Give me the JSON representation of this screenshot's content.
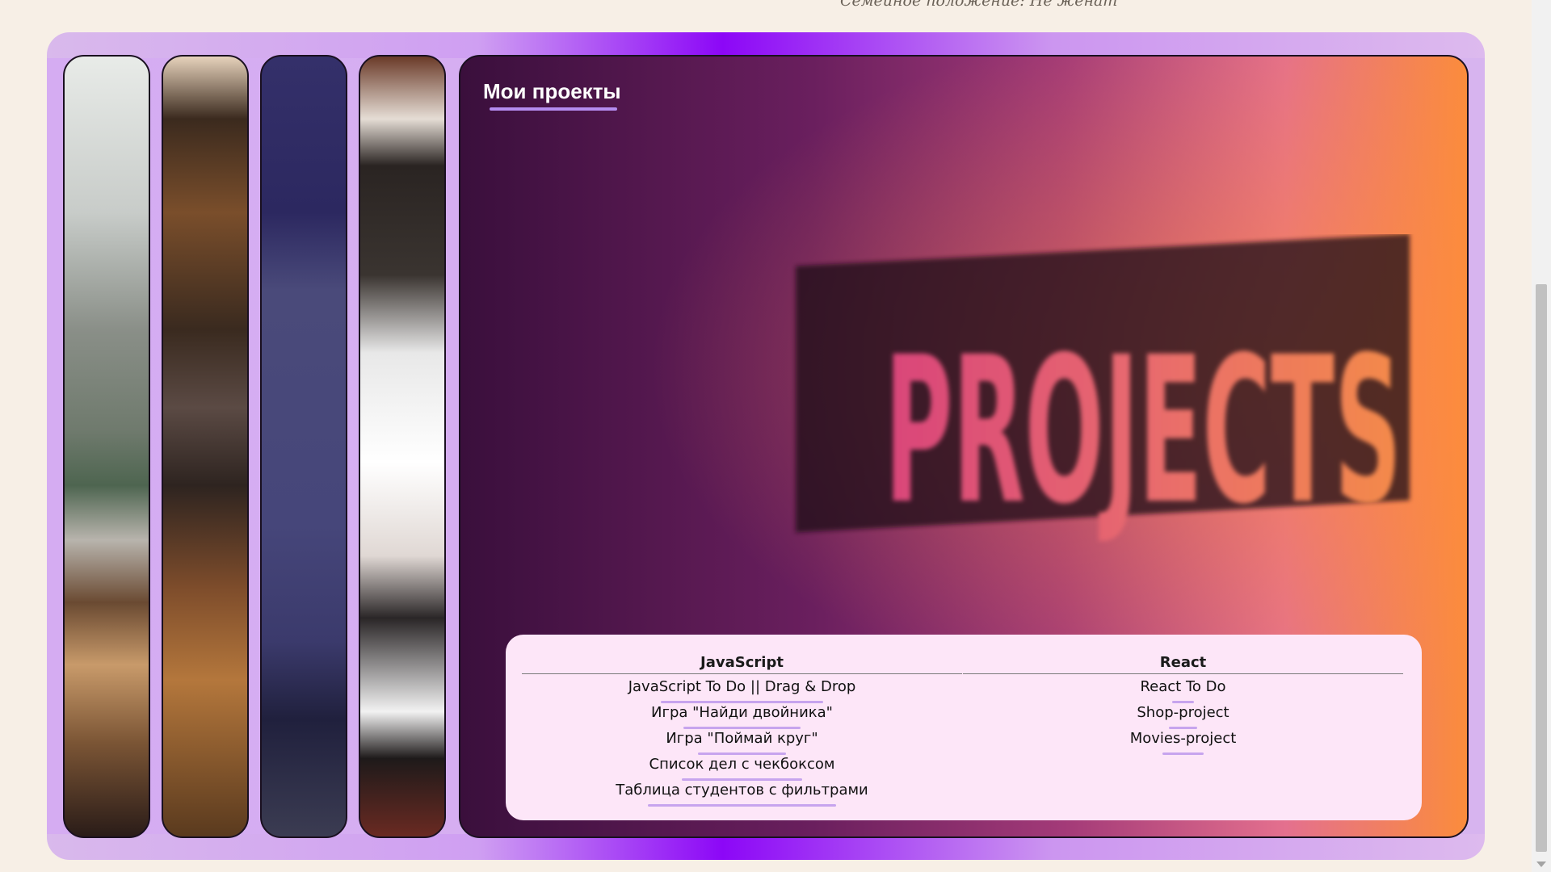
{
  "header": {
    "partial_text": "Семейное положение: Не женат"
  },
  "main": {
    "title": "Мои проекты",
    "image_text": "PROJECTS",
    "columns": [
      {
        "heading": "JavaScript",
        "links": [
          "JavaScript To Do || Drag & Drop",
          "Игра \"Найди двойника\"",
          "Игра \"Поймай круг\"",
          "Список дел с чекбоксом",
          "Таблица студентов с фильтрами"
        ]
      },
      {
        "heading": "React",
        "links": [
          "React To Do",
          "Shop-project",
          "Movies-project"
        ]
      }
    ]
  },
  "colors": {
    "page_bg": "#f7efe6",
    "frame_accent": "#8c07f7",
    "frame_light": "#d5acf2",
    "table_bg": "#fde6f8",
    "link_underline": "#c7a4ee"
  }
}
